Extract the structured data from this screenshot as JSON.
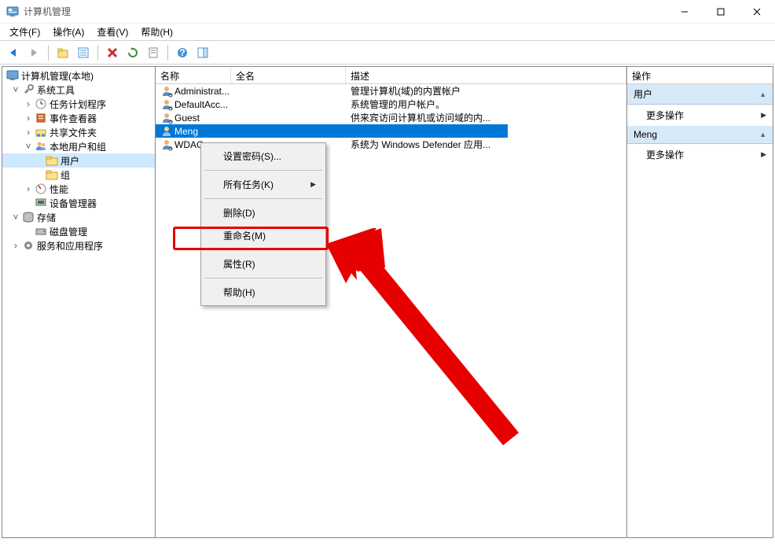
{
  "window": {
    "title": "计算机管理"
  },
  "menubar": {
    "file": "文件(F)",
    "action": "操作(A)",
    "view": "查看(V)",
    "help": "帮助(H)"
  },
  "tree": {
    "root": "计算机管理(本地)",
    "system_tools": "系统工具",
    "task_scheduler": "任务计划程序",
    "event_viewer": "事件查看器",
    "shared_folders": "共享文件夹",
    "local_users_groups": "本地用户和组",
    "users": "用户",
    "groups": "组",
    "performance": "性能",
    "device_manager": "设备管理器",
    "storage": "存储",
    "disk_management": "磁盘管理",
    "services_apps": "服务和应用程序"
  },
  "columns": {
    "name": "名称",
    "fullname": "全名",
    "desc": "描述"
  },
  "users": [
    {
      "name": "Administrat...",
      "full": "",
      "desc": "管理计算机(域)的内置帐户"
    },
    {
      "name": "DefaultAcc...",
      "full": "",
      "desc": "系统管理的用户帐户。"
    },
    {
      "name": "Guest",
      "full": "",
      "desc": "供来宾访问计算机或访问域的内..."
    },
    {
      "name": "Meng",
      "full": "",
      "desc": ""
    },
    {
      "name": "WDAG",
      "full": "",
      "desc": "系统为 Windows Defender 应用..."
    }
  ],
  "context_menu": {
    "set_password": "设置密码(S)...",
    "all_tasks": "所有任务(K)",
    "delete": "删除(D)",
    "rename": "重命名(M)",
    "properties": "属性(R)",
    "help": "帮助(H)"
  },
  "actions": {
    "header": "操作",
    "group1": "用户",
    "group2": "Meng",
    "more": "更多操作"
  }
}
